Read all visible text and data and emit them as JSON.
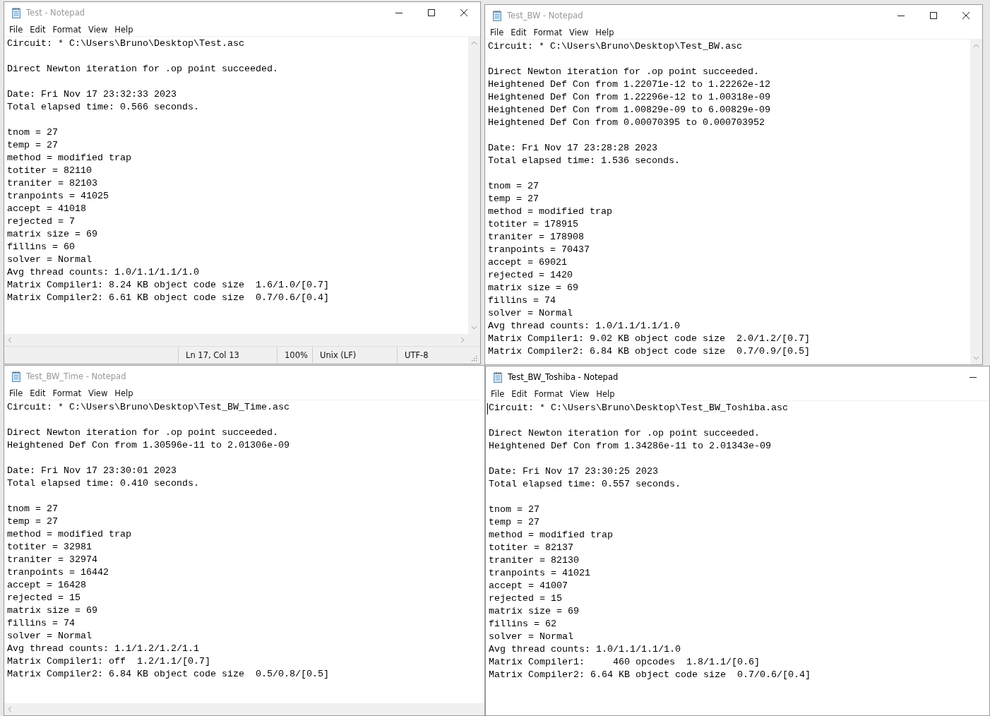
{
  "windows": [
    {
      "title": "Test - Notepad",
      "active": false,
      "menu": [
        "File",
        "Edit",
        "Format",
        "View",
        "Help"
      ],
      "status_bar": [
        "Ln 17, Col 13",
        "100%",
        "Unix (LF)",
        "UTF-8"
      ],
      "blocks": [
        [
          "Circuit: * C:\\Users\\Bruno\\Desktop\\Test.asc"
        ],
        [
          "Direct Newton iteration for .op point succeeded."
        ],
        [
          "Date: Fri Nov 17 23:32:33 2023",
          "Total elapsed time: 0.566 seconds."
        ],
        [
          "tnom = 27",
          "temp = 27",
          "method = modified trap",
          "totiter = 82110",
          "traniter = 82103",
          "tranpoints = 41025",
          "accept = 41018",
          "rejected = 7",
          "matrix size = 69",
          "fillins = 60",
          "solver = Normal",
          "Avg thread counts: 1.0/1.1/1.1/1.0",
          "Matrix Compiler1: 8.24 KB object code size  1.6/1.0/[0.7]",
          "Matrix Compiler2: 6.61 KB object code size  0.7/0.6/[0.4]"
        ]
      ]
    },
    {
      "title": "Test_BW - Notepad",
      "active": false,
      "menu": [
        "File",
        "Edit",
        "Format",
        "View",
        "Help"
      ],
      "blocks": [
        [
          "Circuit: * C:\\Users\\Bruno\\Desktop\\Test_BW.asc"
        ],
        [
          "Direct Newton iteration for .op point succeeded.",
          "Heightened Def Con from 1.22071e-12 to 1.22262e-12",
          "Heightened Def Con from 1.22296e-12 to 1.00318e-09",
          "Heightened Def Con from 1.00829e-09 to 6.00829e-09",
          "Heightened Def Con from 0.00070395 to 0.000703952"
        ],
        [
          "Date: Fri Nov 17 23:28:28 2023",
          "Total elapsed time: 1.536 seconds."
        ],
        [
          "tnom = 27",
          "temp = 27",
          "method = modified trap",
          "totiter = 178915",
          "traniter = 178908",
          "tranpoints = 70437",
          "accept = 69021",
          "rejected = 1420",
          "matrix size = 69",
          "fillins = 74",
          "solver = Normal",
          "Avg thread counts: 1.0/1.1/1.1/1.0",
          "Matrix Compiler1: 9.02 KB object code size  2.0/1.2/[0.7]",
          "Matrix Compiler2: 6.84 KB object code size  0.7/0.9/[0.5]"
        ]
      ]
    },
    {
      "title": "Test_BW_Time - Notepad",
      "active": false,
      "menu": [
        "File",
        "Edit",
        "Format",
        "View",
        "Help"
      ],
      "blocks": [
        [
          "Circuit: * C:\\Users\\Bruno\\Desktop\\Test_BW_Time.asc"
        ],
        [
          "Direct Newton iteration for .op point succeeded.",
          "Heightened Def Con from 1.30596e-11 to 2.01306e-09"
        ],
        [
          "Date: Fri Nov 17 23:30:01 2023",
          "Total elapsed time: 0.410 seconds."
        ],
        [
          "tnom = 27",
          "temp = 27",
          "method = modified trap",
          "totiter = 32981",
          "traniter = 32974",
          "tranpoints = 16442",
          "accept = 16428",
          "rejected = 15",
          "matrix size = 69",
          "fillins = 74",
          "solver = Normal",
          "Avg thread counts: 1.1/1.2/1.2/1.1",
          "Matrix Compiler1: off  1.2/1.1/[0.7]",
          "Matrix Compiler2: 6.84 KB object code size  0.5/0.8/[0.5]"
        ]
      ]
    },
    {
      "title": "Test_BW_Toshiba - Notepad",
      "active": true,
      "menu": [
        "File",
        "Edit",
        "Format",
        "View",
        "Help"
      ],
      "cursor": true,
      "blocks": [
        [
          "Circuit: * C:\\Users\\Bruno\\Desktop\\Test_BW_Toshiba.asc"
        ],
        [
          "Direct Newton iteration for .op point succeeded.",
          "Heightened Def Con from 1.34286e-11 to 2.01343e-09"
        ],
        [
          "Date: Fri Nov 17 23:30:25 2023",
          "Total elapsed time: 0.557 seconds."
        ],
        [
          "tnom = 27",
          "temp = 27",
          "method = modified trap",
          "totiter = 82137",
          "traniter = 82130",
          "tranpoints = 41021",
          "accept = 41007",
          "rejected = 15",
          "matrix size = 69",
          "fillins = 62",
          "solver = Normal",
          "Avg thread counts: 1.0/1.1/1.1/1.0",
          "Matrix Compiler1:     460 opcodes  1.8/1.1/[0.6]",
          "Matrix Compiler2: 6.64 KB object code size  0.7/0.6/[0.4]"
        ]
      ]
    }
  ]
}
